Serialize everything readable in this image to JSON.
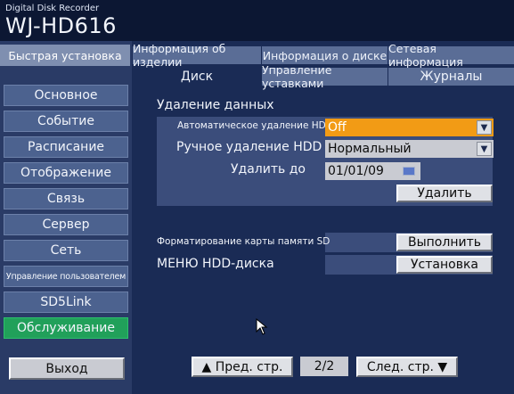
{
  "header": {
    "subtitle": "Digital Disk Recorder",
    "model": "WJ-HD616"
  },
  "sidebar": {
    "quick_setup": "Быстрая установка",
    "items": [
      {
        "label": "Основное"
      },
      {
        "label": "Событие"
      },
      {
        "label": "Расписание"
      },
      {
        "label": "Отображение"
      },
      {
        "label": "Связь"
      },
      {
        "label": "Сервер"
      },
      {
        "label": "Сеть"
      },
      {
        "label": "Управление пользователем"
      },
      {
        "label": "SD5Link"
      },
      {
        "label": "Обслуживание"
      }
    ],
    "active_item": "Обслуживание",
    "exit": "Выход"
  },
  "tabs": {
    "row1": [
      "Информация об изделии",
      "Информация о диске",
      "Сетевая информация"
    ],
    "row2": [
      "Диск",
      "Управление уставками",
      "Журналы"
    ],
    "selected": "Диск"
  },
  "disk": {
    "section_title": "Удаление данных",
    "auto_delete_label": "Автоматическое удаление HDD",
    "auto_delete_value": "Off",
    "manual_delete_label": "Ручное удаление HDD",
    "manual_delete_value": "Нормальный",
    "delete_until_label": "Удалить до",
    "delete_until_value": "01/01/09",
    "delete_button": "Удалить",
    "format_sd_label": "Форматирование карты памяти SD",
    "execute_button": "Выполнить",
    "hdd_menu_label": "МЕНЮ HDD-диска",
    "setup_button": "Установка"
  },
  "pager": {
    "prev": "▲ Пред. стр.",
    "page": "2/2",
    "next": "След. стр. ▼"
  },
  "colors": {
    "active_green": "#21a05a",
    "orange_field": "#f29b15"
  }
}
